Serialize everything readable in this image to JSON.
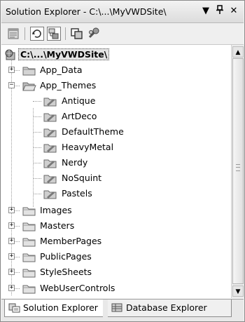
{
  "window": {
    "title": "Solution Explorer - C:\\...\\MyVWDSite\\",
    "menu_glyph": "▼",
    "pin_glyph": "ᛘ",
    "close_glyph": "✕"
  },
  "toolbar": {
    "buttons": [
      {
        "icon": "properties-icon"
      },
      {
        "icon": "refresh-icon"
      },
      {
        "icon": "nest-related-files-icon"
      },
      {
        "icon": "copy-website-icon"
      },
      {
        "icon": "asp-net-configuration-icon"
      }
    ]
  },
  "tree": {
    "root": {
      "label": "C:\\...\\MyVWDSite\\",
      "icon": "website-icon"
    },
    "items": [
      {
        "label": "App_Data",
        "icon": "special-folder-icon",
        "expander": "+"
      },
      {
        "label": "App_Themes",
        "icon": "open-special-folder-icon",
        "expander": "−",
        "children": [
          {
            "label": "Antique",
            "icon": "theme-folder-icon"
          },
          {
            "label": "ArtDeco",
            "icon": "theme-folder-icon"
          },
          {
            "label": "DefaultTheme",
            "icon": "theme-folder-icon"
          },
          {
            "label": "HeavyMetal",
            "icon": "theme-folder-icon"
          },
          {
            "label": "Nerdy",
            "icon": "theme-folder-icon"
          },
          {
            "label": "NoSquint",
            "icon": "theme-folder-icon"
          },
          {
            "label": "Pastels",
            "icon": "theme-folder-icon"
          }
        ]
      },
      {
        "label": "Images",
        "icon": "folder-icon",
        "expander": "+"
      },
      {
        "label": "Masters",
        "icon": "folder-icon",
        "expander": "+"
      },
      {
        "label": "MemberPages",
        "icon": "folder-icon",
        "expander": "+"
      },
      {
        "label": "PublicPages",
        "icon": "folder-icon",
        "expander": "+"
      },
      {
        "label": "StyleSheets",
        "icon": "folder-icon",
        "expander": "+"
      },
      {
        "label": "WebUserControls",
        "icon": "folder-icon",
        "expander": "+"
      }
    ]
  },
  "scrollbar": {
    "up": "▲",
    "down": "▼"
  },
  "tabs": [
    {
      "label": "Solution Explorer",
      "icon": "solution-explorer-icon",
      "active": true
    },
    {
      "label": "Database Explorer",
      "icon": "database-explorer-icon",
      "active": false
    }
  ]
}
